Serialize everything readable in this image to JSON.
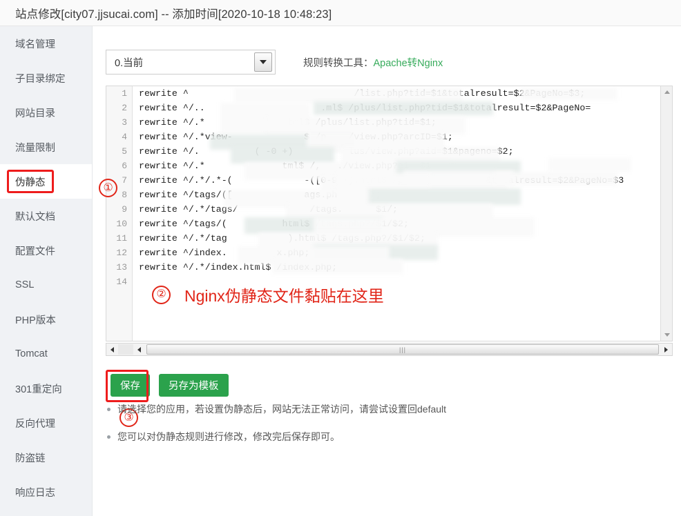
{
  "header": {
    "title": "站点修改[city07.jjsucai.com] -- 添加时间[2020-10-18 10:48:23]"
  },
  "sidebar": {
    "items": [
      {
        "label": "域名管理",
        "active": false
      },
      {
        "label": "子目录绑定",
        "active": false
      },
      {
        "label": "网站目录",
        "active": false
      },
      {
        "label": "流量限制",
        "active": false
      },
      {
        "label": "伪静态",
        "active": true
      },
      {
        "label": "默认文档",
        "active": false
      },
      {
        "label": "配置文件",
        "active": false
      },
      {
        "label": "SSL",
        "active": false
      },
      {
        "label": "PHP版本",
        "active": false
      },
      {
        "label": "Tomcat",
        "active": false
      },
      {
        "label": "301重定向",
        "active": false
      },
      {
        "label": "反向代理",
        "active": false
      },
      {
        "label": "防盗链",
        "active": false
      },
      {
        "label": "响应日志",
        "active": false
      }
    ]
  },
  "toolbar": {
    "select_value": "0.当前",
    "select_options": [
      "0.当前"
    ],
    "tool_label": "规则转换工具：",
    "tool_link": "Apache转Nginx"
  },
  "editor": {
    "line_numbers": [
      "1",
      "2",
      "3",
      "4",
      "5",
      "6",
      "7",
      "8",
      "9",
      "10",
      "11",
      "12",
      "13",
      "14"
    ],
    "lines": [
      "rewrite ^                              /list.php?tid=$1&totalresult=$2&PageNo=$3;",
      "rewrite ^/..                     .ml$ /plus/list.php?tid=$1&totalresult=$2&PageNo=",
      "rewrite ^/.*               tml$ /plus/list.php?tid=$1;",
      "rewrite ^/.*view-             $ /p    /view.php?arcID=$1;",
      "rewrite ^/.          ( -0 +)          lus/view.php?aid=$1&pageno=$2;",
      "rewrite ^/.*              tml$ /,   ./view.php?ei  $1",
      "rewrite ^/.*/.*-(             -([0-9 +).html$ /pl              &totalresult=$2&PageNo=$3",
      "rewrite ^/tags/([             ags.ph      /;",
      "rewrite ^/.*/tags/             /tags.      $1/;",
      "rewrite ^/tags/(          html$ /tags.php?/$1/$2;",
      "rewrite ^/.*/tag           ).html$ /tags.php?/$1/$2;",
      "rewrite ^/index.         x.php;",
      "rewrite ^/.*/index.html$ /index.php;",
      ""
    ],
    "annotation_number": "②",
    "annotation_text": "Nginx伪静态文件黏贴在这里",
    "scroll_grip": "|||"
  },
  "annotations": {
    "step1": "①",
    "step3": "③",
    "highlight_color": "#ee1c1c",
    "note_color": "#e12518"
  },
  "buttons": {
    "save": "保存",
    "save_as_template": "另存为模板",
    "accent_color": "#2ba24c"
  },
  "notes": [
    "请选择您的应用，若设置伪静态后，网站无法正常访问，请尝试设置回default",
    "您可以对伪静态规则进行修改，修改完后保存即可。"
  ]
}
